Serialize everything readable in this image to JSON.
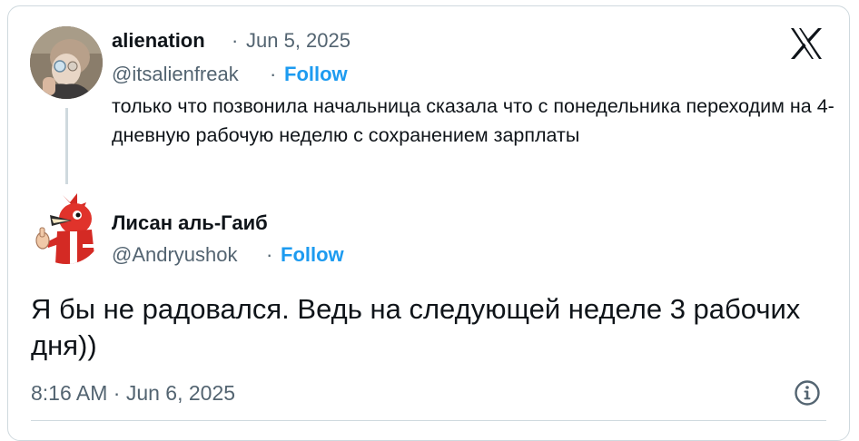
{
  "quoted_tweet": {
    "author_name": "alienation",
    "separator": "·",
    "date": "Jun 5, 2025",
    "handle": "@itsalienfreak",
    "follow_label": "Follow",
    "text": "только что позвонила начальница сказала что с понедельника переходим на 4-дневную рабочую неделю с сохранением зарплаты"
  },
  "reply_tweet": {
    "author_name": "Лисан аль-Гаиб",
    "handle": "@Andryushok",
    "separator": "·",
    "follow_label": "Follow",
    "text": "Я бы не радовался. Ведь на следующей неделе 3 рабочих дня))",
    "timestamp": "8:16 AM · Jun 6, 2025"
  },
  "icons": {
    "platform_logo": "x-logo-icon",
    "info": "info-icon"
  },
  "colors": {
    "follow": "#1d9bf0",
    "text": "#0f1419",
    "muted": "#536471",
    "border": "#cfd9de"
  }
}
